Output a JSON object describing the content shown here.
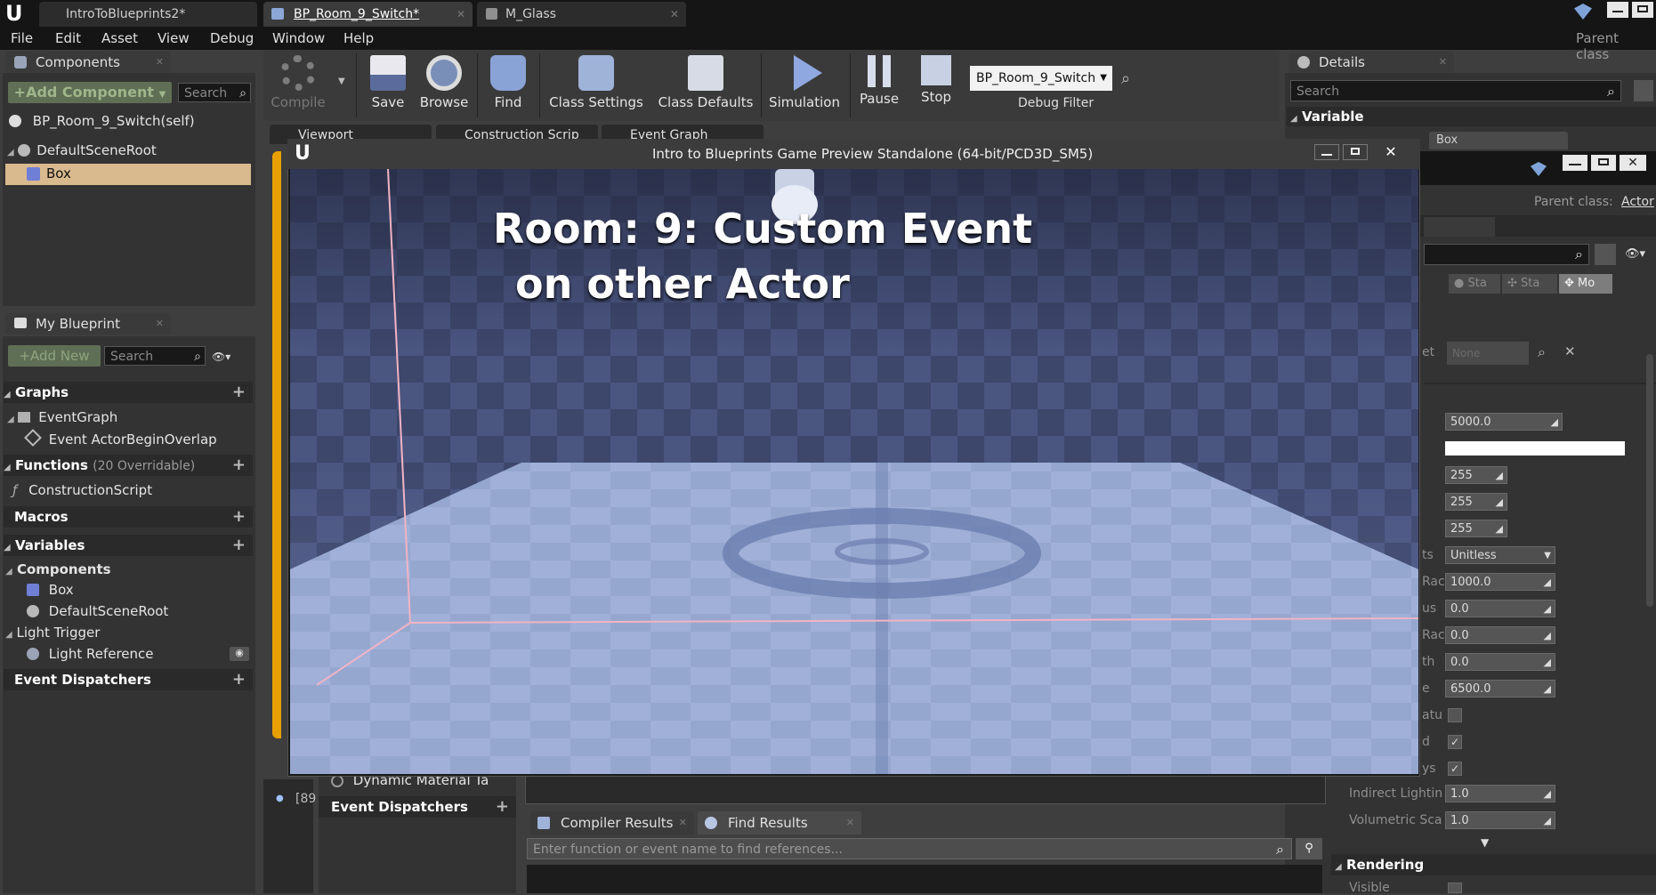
{
  "titlebar": {
    "tabs": [
      "IntroToBlueprints2*",
      "BP_Room_9_Switch*",
      "M_Glass"
    ],
    "parent_class_label": "Parent class"
  },
  "menu": [
    "File",
    "Edit",
    "Asset",
    "View",
    "Debug",
    "Window",
    "Help"
  ],
  "components": {
    "tab": "Components",
    "add_button": "+Add Component",
    "search_placeholder": "Search",
    "self_item": "BP_Room_9_Switch(self)",
    "root": "DefaultSceneRoot",
    "box": "Box"
  },
  "toolbar": {
    "compile": "Compile",
    "save": "Save",
    "browse": "Browse",
    "find": "Find",
    "class_settings": "Class Settings",
    "class_defaults": "Class Defaults",
    "simulation": "Simulation",
    "pause": "Pause",
    "stop": "Stop",
    "debug_object": "BP_Room_9_Switch",
    "debug_filter": "Debug Filter"
  },
  "editor_tabs": [
    "Viewport",
    "Construction Scrip",
    "Event Graph"
  ],
  "my_blueprint": {
    "tab": "My Blueprint",
    "add_new": "+Add New",
    "search_placeholder": "Search",
    "graphs_header": "Graphs",
    "event_graph": "EventGraph",
    "event_item": "Event ActorBeginOverlap",
    "functions_header": "Functions",
    "functions_count": "(20 Overridable)",
    "construction_script": "ConstructionScript",
    "macros_header": "Macros",
    "variables_header": "Variables",
    "components_group": "Components",
    "var_box": "Box",
    "var_root": "DefaultSceneRoot",
    "light_trigger_group": "Light Trigger",
    "light_reference": "Light Reference",
    "event_dispatchers_header": "Event Dispatchers"
  },
  "game_window": {
    "title": "Intro to Blueprints Game Preview Standalone (64-bit/PCD3D_SM5)",
    "caption_line1": "Room: 9: Custom Event",
    "caption_line2": "on other Actor"
  },
  "details": {
    "tab": "Details",
    "search_placeholder": "Search",
    "variable_header": "Variable",
    "box_tab": "Box",
    "parent_class_label": "Parent class:",
    "parent_class_value": "Actor",
    "mode_buttons": [
      "Sta",
      "Sta",
      "Mo"
    ],
    "none_field": "None",
    "label_fragments": [
      "et",
      "ts",
      "Rac",
      "us",
      "Rac",
      "th",
      "e",
      "atu",
      "d",
      "ys"
    ],
    "fields": [
      "5000.0",
      "",
      "255",
      "255",
      "255",
      "Unitless",
      "1000.0",
      "0.0",
      "0.0",
      "0.0",
      "6500.0"
    ],
    "indirect_lighting_label": "Indirect Lightin",
    "indirect_lighting_value": "1.0",
    "volumetric_label": "Volumetric Sca",
    "volumetric_value": "1.0",
    "rendering_header": "Rendering",
    "visible_label": "Visible"
  },
  "bottom": {
    "dynamic_material": "Dynamic Material Ta",
    "event_dispatchers": "Event Dispatchers",
    "side_text": "[89",
    "compiler_results": "Compiler Results",
    "find_results": "Find Results",
    "find_placeholder": "Enter function or event name to find references..."
  },
  "colors": {
    "selection": "#d9b98e",
    "accent_orange": "#e8a000"
  }
}
